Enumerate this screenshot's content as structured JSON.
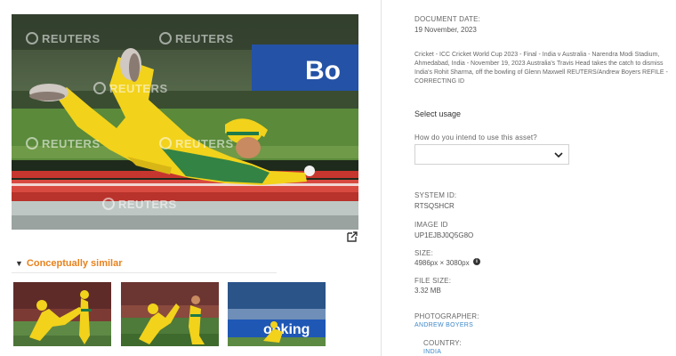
{
  "metadata": {
    "document_date_label": "DOCUMENT DATE:",
    "document_date": "19 November, 2023",
    "caption": "Cricket - ICC Cricket World Cup 2023 - Final - India v Australia - Narendra Modi Stadium, Ahmedabad, India - November 19, 2023 Australia's Travis Head takes the catch to dismiss India's Rohit Sharma, off the bowling of Glenn Maxwell REUTERS/Andrew Boyers REFILE - CORRECTING ID",
    "system_id_label": "SYSTEM ID:",
    "system_id": "RTSQSHCR",
    "image_id_label": "IMAGE ID",
    "image_id": "UP1EJBJ0Q5G8O",
    "size_label": "SIZE:",
    "size": "4986px × 3080px",
    "file_size_label": "FILE SIZE:",
    "file_size": "3.32 MB",
    "photographer_label": "PHOTOGRAPHER:",
    "photographer": "ANDREW BOYERS",
    "country_label": "COUNTRY:",
    "country": "INDIA"
  },
  "usage": {
    "heading": "Select usage",
    "question": "How do you intend to use this asset?",
    "selected": ""
  },
  "image": {
    "watermark": "REUTERS",
    "board_text": "Bo",
    "colors": {
      "jersey": "#f2d21b",
      "green": "#1e7a4a",
      "pitch": "#2d6b2a"
    }
  },
  "similar": {
    "title": "Conceptually similar",
    "thumb3_board_text": "ooking"
  },
  "icons": {
    "external_link": "external-link-icon",
    "expand": "triangle-down-icon",
    "chevron": "chevron-down-icon",
    "info": "info-icon"
  }
}
